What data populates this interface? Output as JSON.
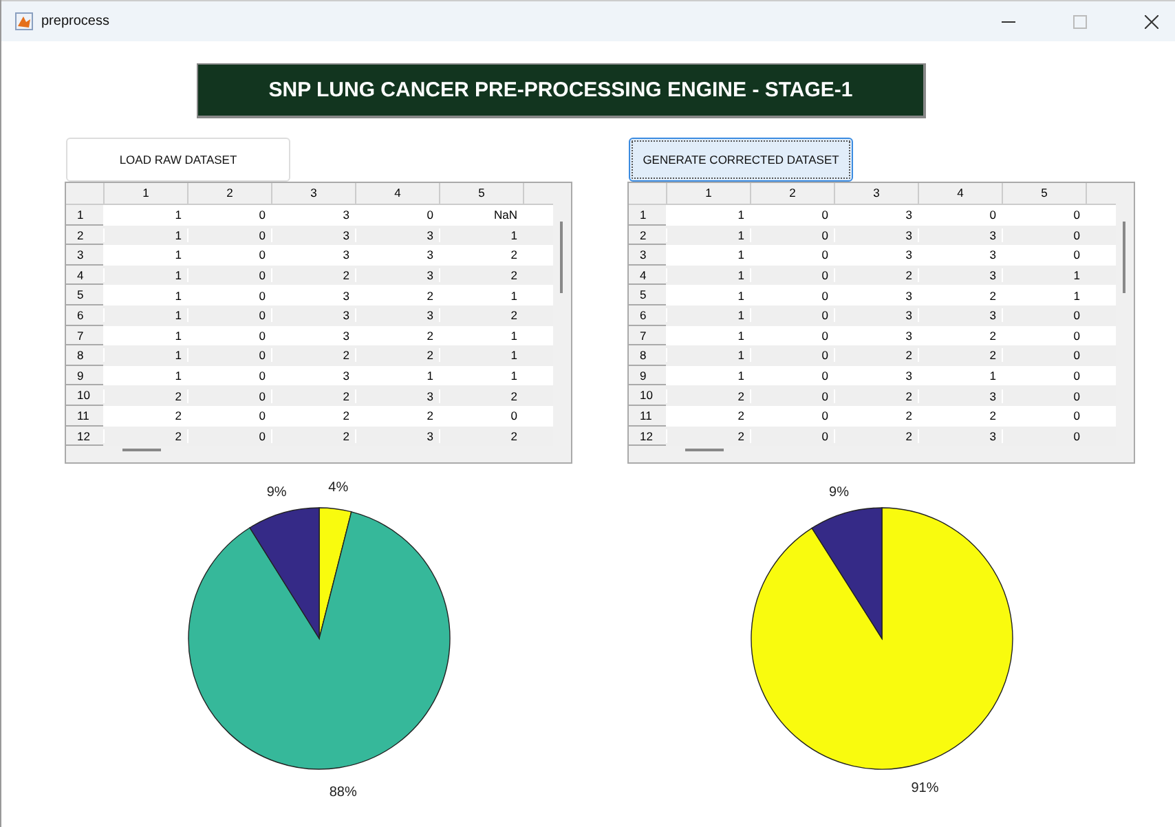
{
  "window": {
    "title": "preprocess"
  },
  "banner": "SNP LUNG CANCER PRE-PROCESSING ENGINE - STAGE-1",
  "panels": [
    {
      "button": {
        "label": "LOAD RAW DATASET",
        "focused": false
      },
      "table": {
        "columns": [
          "1",
          "2",
          "3",
          "4",
          "5"
        ],
        "row_headers": [
          "1",
          "2",
          "3",
          "4",
          "5",
          "6",
          "7",
          "8",
          "9",
          "10",
          "11",
          "12"
        ],
        "rows": [
          [
            "1",
            "0",
            "3",
            "0",
            "NaN"
          ],
          [
            "1",
            "0",
            "3",
            "3",
            "1"
          ],
          [
            "1",
            "0",
            "3",
            "3",
            "2"
          ],
          [
            "1",
            "0",
            "2",
            "3",
            "2"
          ],
          [
            "1",
            "0",
            "3",
            "2",
            "1"
          ],
          [
            "1",
            "0",
            "3",
            "3",
            "2"
          ],
          [
            "1",
            "0",
            "3",
            "2",
            "1"
          ],
          [
            "1",
            "0",
            "2",
            "2",
            "1"
          ],
          [
            "1",
            "0",
            "3",
            "1",
            "1"
          ],
          [
            "2",
            "0",
            "2",
            "3",
            "2"
          ],
          [
            "2",
            "0",
            "2",
            "2",
            "0"
          ],
          [
            "2",
            "0",
            "2",
            "3",
            "2"
          ]
        ]
      },
      "chart_data": {
        "type": "pie",
        "values": [
          4,
          88,
          9
        ],
        "colors": [
          "#f9fb0e",
          "#36b89a",
          "#352a87"
        ],
        "value_labels": [
          "4%",
          "88%",
          "9%"
        ]
      }
    },
    {
      "button": {
        "label": "GENERATE CORRECTED DATASET",
        "focused": true
      },
      "table": {
        "columns": [
          "1",
          "2",
          "3",
          "4",
          "5"
        ],
        "row_headers": [
          "1",
          "2",
          "3",
          "4",
          "5",
          "6",
          "7",
          "8",
          "9",
          "10",
          "11",
          "12"
        ],
        "rows": [
          [
            "1",
            "0",
            "3",
            "0",
            "0"
          ],
          [
            "1",
            "0",
            "3",
            "3",
            "0"
          ],
          [
            "1",
            "0",
            "3",
            "3",
            "0"
          ],
          [
            "1",
            "0",
            "2",
            "3",
            "1"
          ],
          [
            "1",
            "0",
            "3",
            "2",
            "1"
          ],
          [
            "1",
            "0",
            "3",
            "3",
            "0"
          ],
          [
            "1",
            "0",
            "3",
            "2",
            "0"
          ],
          [
            "1",
            "0",
            "2",
            "2",
            "0"
          ],
          [
            "1",
            "0",
            "3",
            "1",
            "0"
          ],
          [
            "2",
            "0",
            "2",
            "3",
            "0"
          ],
          [
            "2",
            "0",
            "2",
            "2",
            "0"
          ],
          [
            "2",
            "0",
            "2",
            "3",
            "0"
          ]
        ]
      },
      "chart_data": {
        "type": "pie",
        "values": [
          91,
          9
        ],
        "colors": [
          "#f9fb0e",
          "#352a87"
        ],
        "value_labels": [
          "91%",
          "9%"
        ]
      }
    }
  ]
}
